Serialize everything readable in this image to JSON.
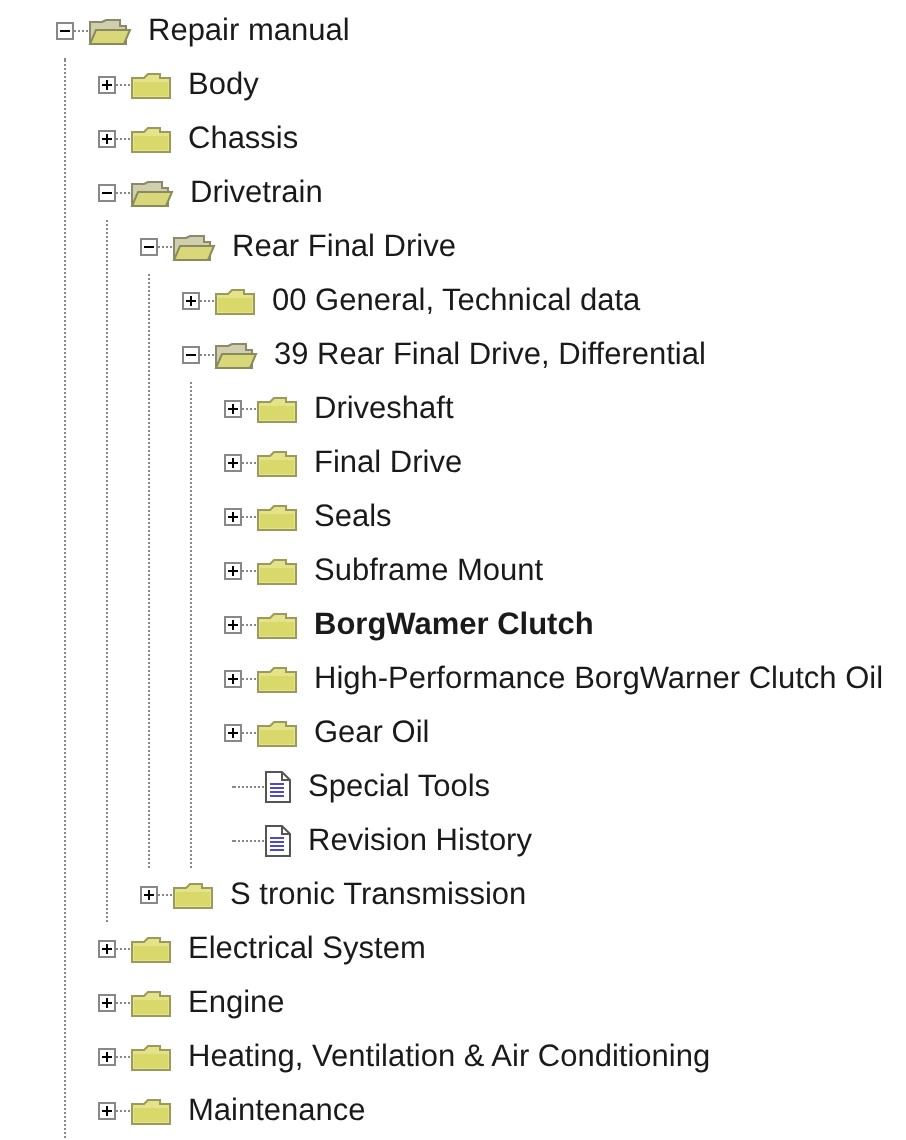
{
  "tree": [
    {
      "label": "Repair manual",
      "kind": "folder",
      "expanded": true,
      "selected": false,
      "children": [
        {
          "label": "Body",
          "kind": "folder",
          "expanded": false,
          "selected": false
        },
        {
          "label": "Chassis",
          "kind": "folder",
          "expanded": false,
          "selected": false
        },
        {
          "label": "Drivetrain",
          "kind": "folder",
          "expanded": true,
          "selected": false,
          "children": [
            {
              "label": "Rear Final Drive",
              "kind": "folder",
              "expanded": true,
              "selected": false,
              "children": [
                {
                  "label": "00 General, Technical data",
                  "kind": "folder",
                  "expanded": false,
                  "selected": false
                },
                {
                  "label": "39 Rear Final Drive, Differential",
                  "kind": "folder",
                  "expanded": true,
                  "selected": false,
                  "children": [
                    {
                      "label": "Driveshaft",
                      "kind": "folder",
                      "expanded": false,
                      "selected": false
                    },
                    {
                      "label": "Final Drive",
                      "kind": "folder",
                      "expanded": false,
                      "selected": false
                    },
                    {
                      "label": "Seals",
                      "kind": "folder",
                      "expanded": false,
                      "selected": false
                    },
                    {
                      "label": "Subframe Mount",
                      "kind": "folder",
                      "expanded": false,
                      "selected": false
                    },
                    {
                      "label": "BorgWamer Clutch",
                      "kind": "folder",
                      "expanded": false,
                      "selected": true
                    },
                    {
                      "label": "High-Performance BorgWarner Clutch Oil",
                      "kind": "folder",
                      "expanded": false,
                      "selected": false
                    },
                    {
                      "label": "Gear Oil",
                      "kind": "folder",
                      "expanded": false,
                      "selected": false
                    },
                    {
                      "label": "Special Tools",
                      "kind": "document",
                      "selected": false
                    },
                    {
                      "label": "Revision History",
                      "kind": "document",
                      "selected": false
                    }
                  ]
                }
              ]
            },
            {
              "label": "S tronic Transmission",
              "kind": "folder",
              "expanded": false,
              "selected": false
            }
          ]
        },
        {
          "label": "Electrical System",
          "kind": "folder",
          "expanded": false,
          "selected": false
        },
        {
          "label": "Engine",
          "kind": "folder",
          "expanded": false,
          "selected": false
        },
        {
          "label": "Heating, Ventilation & Air Conditioning",
          "kind": "folder",
          "expanded": false,
          "selected": false
        },
        {
          "label": "Maintenance",
          "kind": "folder",
          "expanded": false,
          "selected": false
        }
      ]
    }
  ]
}
